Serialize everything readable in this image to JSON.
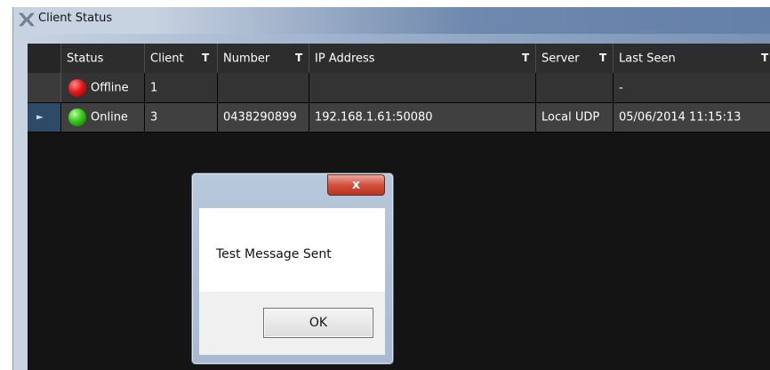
{
  "window": {
    "title": "Client Status"
  },
  "grid": {
    "columns": [
      {
        "label": "Status",
        "filter": false
      },
      {
        "label": "Client",
        "filter": true
      },
      {
        "label": "Number",
        "filter": true
      },
      {
        "label": "IP Address",
        "filter": true
      },
      {
        "label": "Server",
        "filter": true
      },
      {
        "label": "Last Seen",
        "filter": true
      }
    ],
    "filter_icon": "T",
    "rows": [
      {
        "status": "Offline",
        "status_color": "#e21919",
        "client": "1",
        "number": "",
        "ip": "",
        "server": "",
        "last_seen": "-"
      },
      {
        "status": "Online",
        "status_color": "#35c81a",
        "client": "3",
        "number": "0438290899",
        "ip": "192.168.1.61:50080",
        "server": "Local UDP",
        "last_seen": "05/06/2014 11:15:13",
        "current": true
      }
    ],
    "current_row_indicator": "►"
  },
  "dialog": {
    "close_glyph": "x",
    "message": "Test Message Sent",
    "ok_label": "OK"
  },
  "icons": {
    "app": "client-status-app-icon",
    "status_offline": "red-status-dot-icon",
    "status_online": "green-status-dot-icon",
    "filter": "filter-icon",
    "row_indicator": "current-row-arrow-icon",
    "close": "close-icon"
  }
}
